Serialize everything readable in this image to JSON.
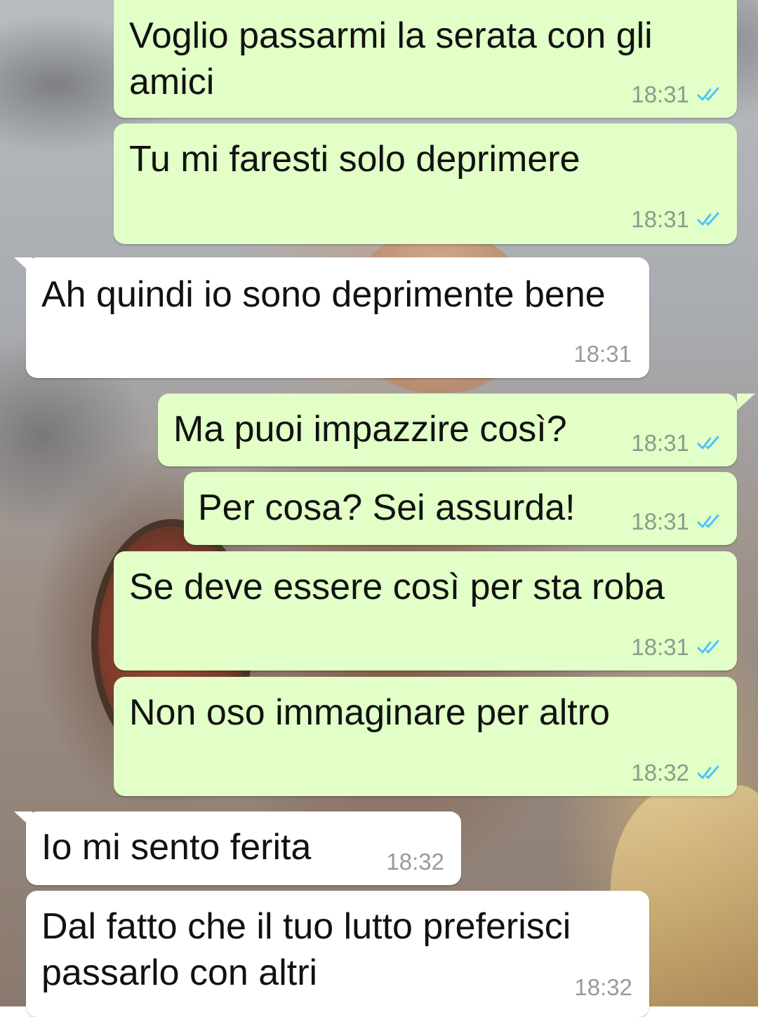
{
  "colors": {
    "outgoing_bubble": "#e1ffc7",
    "incoming_bubble": "#ffffff",
    "read_ticks": "#4fc3f7"
  },
  "messages": [
    {
      "direction": "outgoing",
      "text": "Voglio passarmi la serata con gli\namici",
      "time": "18:31",
      "status_icon": "double-check-read-icon"
    },
    {
      "direction": "outgoing",
      "text": "Tu mi faresti solo deprimere",
      "time": "18:31",
      "status_icon": "double-check-read-icon"
    },
    {
      "direction": "incoming",
      "text": "Ah quindi io sono deprimente bene",
      "time": "18:31"
    },
    {
      "direction": "outgoing",
      "text": "Ma puoi impazzire così?",
      "time": "18:31",
      "status_icon": "double-check-read-icon"
    },
    {
      "direction": "outgoing",
      "text": "Per cosa? Sei assurda!",
      "time": "18:31",
      "status_icon": "double-check-read-icon"
    },
    {
      "direction": "outgoing",
      "text": "Se deve essere così per sta roba",
      "time": "18:31",
      "status_icon": "double-check-read-icon"
    },
    {
      "direction": "outgoing",
      "text": "Non oso immaginare per altro",
      "time": "18:32",
      "status_icon": "double-check-read-icon"
    },
    {
      "direction": "incoming",
      "text": "Io mi sento ferita",
      "time": "18:32"
    },
    {
      "direction": "incoming",
      "text": "Dal fatto che il tuo lutto preferisci\npassarlo con altri",
      "time": "18:32"
    }
  ]
}
